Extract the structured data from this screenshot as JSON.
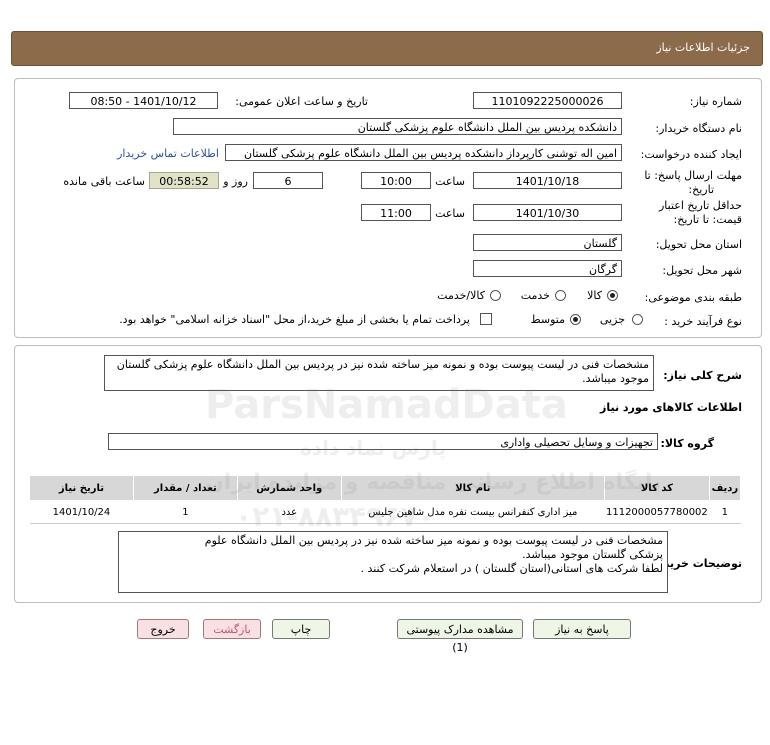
{
  "header": {
    "title": "جزئیات اطلاعات نیاز"
  },
  "form": {
    "need_number_label": "شماره نیاز:",
    "need_number": "1101092225000026",
    "announce_label": "تاریخ و ساعت اعلان عمومی:",
    "announce_value": "1401/10/12 - 08:50",
    "buyer_org_label": "نام دستگاه خریدار:",
    "buyer_org": "دانشکده پردیس بین الملل دانشگاه علوم پزشکی گلستان",
    "creator_label": "ایجاد کننده درخواست:",
    "creator": "امین اله توشنی کارپرداز دانشکده پردیس بین الملل دانشگاه علوم پزشکی گلستان",
    "contact_link": "اطلاعات تماس خریدار",
    "deadline_label_1": "مهلت ارسال پاسخ: تا",
    "deadline_label_2": "تاریخ:",
    "deadline_date": "1401/10/18",
    "time_label": "ساعت",
    "deadline_time": "10:00",
    "days_value": "6",
    "days_label": "روز و",
    "remaining_time": "00:58:52",
    "remaining_label": "ساعت باقی مانده",
    "validity_label_1": "حداقل تاریخ اعتبار",
    "validity_label_2": "قیمت: تا تاریخ:",
    "validity_date": "1401/10/30",
    "validity_time_label": "ساعت",
    "validity_time": "11:00",
    "province_label": "استان محل تحویل:",
    "province": "گلستان",
    "city_label": "شهر محل تحویل:",
    "city": "گرگان",
    "category_label": "طبقه بندی موضوعی:",
    "category_options": [
      "کالا",
      "خدمت",
      "کالا/خدمت"
    ],
    "process_label": "نوع فرآیند خرید :",
    "process_options": [
      "جزیی",
      "متوسط"
    ],
    "payment_note": "پرداخت تمام یا بخشی از مبلغ خرید،از محل \"اسناد خزانه اسلامی\" خواهد بود."
  },
  "summary": {
    "label": "شرح کلی نیاز:",
    "text": "مشخصات فنی در لیست پیوست بوده و نمونه میز ساخته شده نیز در پردیس بین الملل دانشگاه علوم پزشکی گلستان موجود میباشد."
  },
  "goods": {
    "section_title": "اطلاعات کالاهای مورد نیاز",
    "group_label": "گروه کالا:",
    "group_value": "تجهیزات و وسایل تحصیلی واداری",
    "columns": [
      "ردیف",
      "کد کالا",
      "نام کالا",
      "واحد شمارش",
      "تعداد / مقدار",
      "تاریخ نیاز"
    ],
    "rows": [
      [
        "1",
        "1112000057780002",
        "میز اداری کنفرانس بیست نفره مدل شاهین جلیس",
        "عدد",
        "1",
        "1401/10/24"
      ]
    ]
  },
  "buyer_notes": {
    "label": "توضیحات خریدار:",
    "lines": [
      "مشخصات فنی در لیست پیوست بوده و نمونه میز ساخته شده نیز در پردیس بین الملل دانشگاه علوم",
      "پزشکی گلستان موجود میباشد.",
      "لطفا شرکت های استانی(استان گلستان ) در استعلام شرکت کنند ."
    ]
  },
  "buttons": {
    "respond": "پاسخ به نیاز",
    "attachments": "مشاهده مدارک پیوستی (1)",
    "print": "چاپ",
    "back": "بازگشت",
    "exit": "خروج"
  },
  "watermark": {
    "brand": "ParsNamadData",
    "line1": "پایگاه اطلاع رسانی مناقصه و مزایده ایران",
    "line2": "پارس نماد داده",
    "phone": "۰۲۱-۸۸۳۴۹۶۷۰"
  }
}
